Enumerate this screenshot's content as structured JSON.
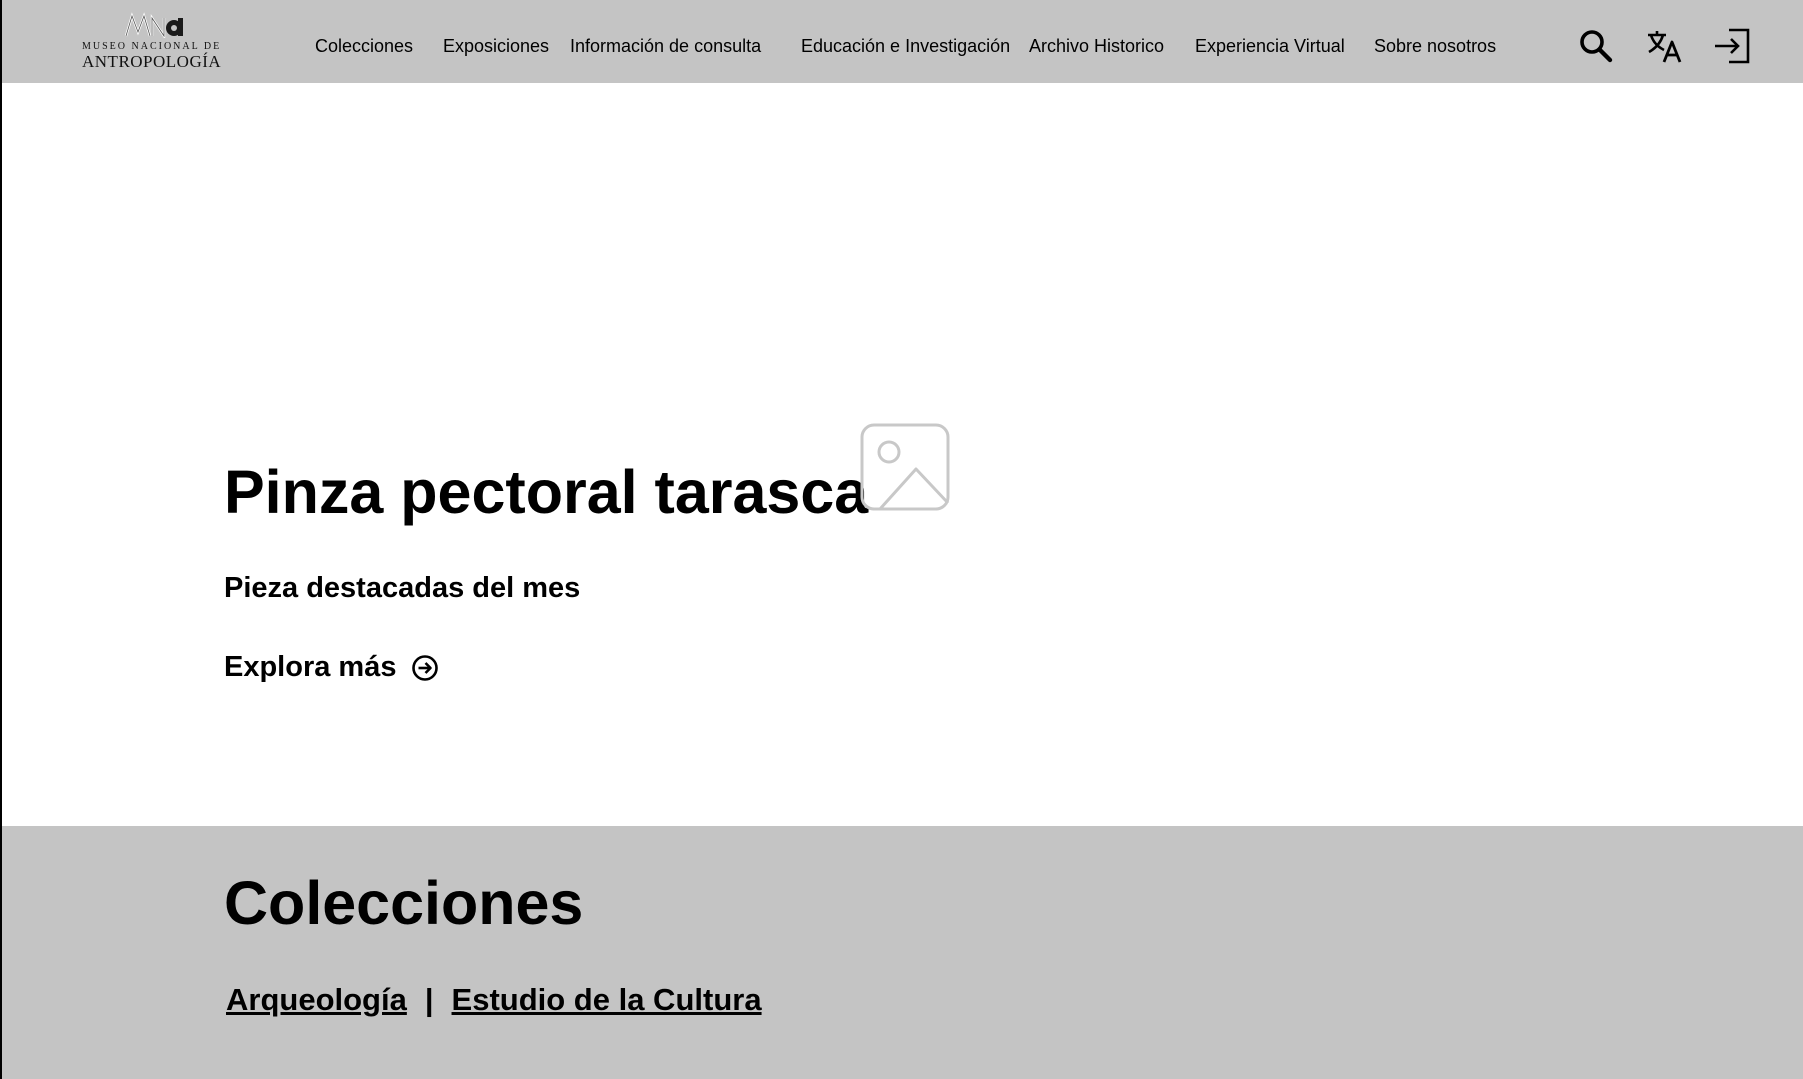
{
  "brand": {
    "mark": "MNa",
    "line1": "MUSEO NACIONAL DE",
    "line2": "ANTROPOLOGÍA"
  },
  "nav": {
    "items": [
      {
        "label": "Colecciones"
      },
      {
        "label": "Exposiciones"
      },
      {
        "label": "Información de consulta"
      },
      {
        "label": "Educación e Investigación"
      },
      {
        "label": "Archivo Historico"
      },
      {
        "label": "Experiencia Virtual"
      },
      {
        "label": "Sobre nosotros"
      }
    ],
    "icons": [
      "search-icon",
      "translate-icon",
      "login-icon"
    ]
  },
  "hero": {
    "title": "Pinza pectoral tarasca",
    "subtitle": "Pieza destacadas del mes",
    "cta_label": "Explora más",
    "image_icon": "image-placeholder-icon"
  },
  "collections": {
    "title": "Colecciones",
    "links": [
      {
        "label": "Arqueología"
      },
      {
        "label": "Estudio de la Cultura"
      }
    ],
    "separator": "|"
  },
  "colors": {
    "header_bg": "#c4c4c4",
    "band_bg": "#c4c4c4",
    "page_bg": "#ffffff",
    "text": "#000000",
    "placeholder_icon": "#c8c8c8"
  }
}
